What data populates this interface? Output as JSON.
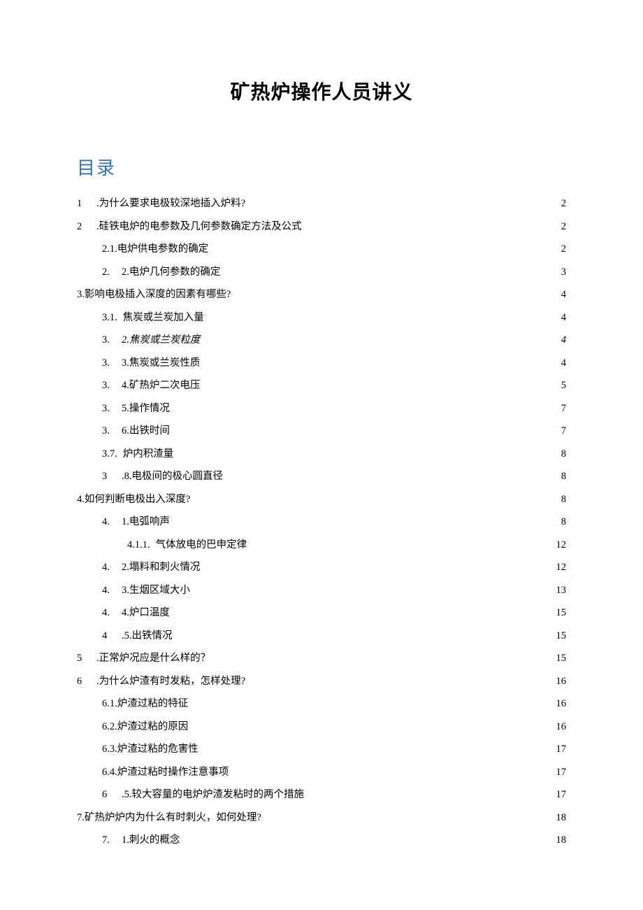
{
  "title": "矿热炉操作人员讲义",
  "toc_heading": "目录",
  "toc": [
    {
      "level": 1,
      "num": "1",
      "text": ".为什么要求电极较深地插入炉料?",
      "page": "2"
    },
    {
      "level": 1,
      "num": "2",
      "text": ".硅铁电炉的电参数及几何参数确定方法及公式",
      "page": "2"
    },
    {
      "level": 2,
      "num": "",
      "text": "2.1.电炉供电参数的确定",
      "page": "2"
    },
    {
      "level": 2,
      "num": "2.",
      "text": "2.电炉几何参数的确定",
      "page": "3"
    },
    {
      "level": 1,
      "num": "",
      "text": "3.影响电极插入深度的因素有哪些?",
      "page": "4"
    },
    {
      "level": 2,
      "num": "3.1.",
      "text": "焦炭或兰炭加入量",
      "page": "4"
    },
    {
      "level": 2,
      "num": "3.",
      "text": "2.焦炭或兰炭粒度",
      "page": "4",
      "italic": true
    },
    {
      "level": 2,
      "num": "3.",
      "text": "3.焦炭或兰炭性质",
      "page": "4"
    },
    {
      "level": 2,
      "num": "3.",
      "text": "4.矿热炉二次电压",
      "page": "5"
    },
    {
      "level": 2,
      "num": "3.",
      "text": "5.操作情况",
      "page": "7"
    },
    {
      "level": 2,
      "num": "3.",
      "text": "6.出铁时间",
      "page": "7"
    },
    {
      "level": 2,
      "num": "3.7.",
      "text": "炉内积渣量",
      "page": "8"
    },
    {
      "level": 2,
      "num": "3",
      "text": ".8.电极间的极心圆直径",
      "page": "8"
    },
    {
      "level": 1,
      "num": "",
      "text": "4.如何判断电极出入深度?",
      "page": "8"
    },
    {
      "level": 2,
      "num": "4.",
      "text": "1.电弧响声",
      "page": "8"
    },
    {
      "level": 3,
      "num": "4.1.1.",
      "text": "气体放电的巴申定律",
      "page": "12"
    },
    {
      "level": 2,
      "num": "4.",
      "text": "2.塌料和刺火情况",
      "page": "12"
    },
    {
      "level": 2,
      "num": "4.",
      "text": "3.生烟区域大小",
      "page": "13"
    },
    {
      "level": 2,
      "num": "4.",
      "text": "4.炉口温度",
      "page": "15"
    },
    {
      "level": 2,
      "num": "4",
      "text": ".5.出铁情况",
      "page": "15"
    },
    {
      "level": 1,
      "num": "5",
      "text": ".正常炉况应是什么样的？",
      "page": "15"
    },
    {
      "level": 1,
      "num": "6",
      "text": ".为什么炉渣有时发粘，怎样处理?",
      "page": "16"
    },
    {
      "level": 2,
      "num": "",
      "text": "6.1.炉渣过粘的特征",
      "page": "16"
    },
    {
      "level": 2,
      "num": "",
      "text": "6.2.炉渣过粘的原因",
      "page": "16"
    },
    {
      "level": 2,
      "num": "",
      "text": "6.3.炉渣过粘的危害性",
      "page": "17"
    },
    {
      "level": 2,
      "num": "",
      "text": "6.4.炉渣过粘时操作注意事项",
      "page": "17"
    },
    {
      "level": 2,
      "num": "6",
      "text": ".5.较大容量的电炉炉渣发粘时的两个措施",
      "page": "17"
    },
    {
      "level": 1,
      "num": "",
      "text": "7.矿热炉炉内为什么有时刺火，如何处理?",
      "page": "18"
    },
    {
      "level": 2,
      "num": "7.",
      "text": "1.刺火的概念",
      "page": "18"
    }
  ]
}
